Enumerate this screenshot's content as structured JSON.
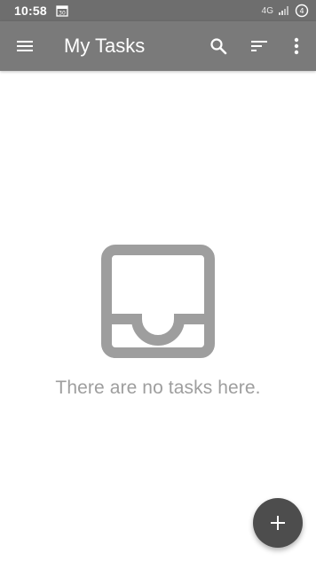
{
  "status_bar": {
    "time": "10:58",
    "calendar_icon": "calendar-icon",
    "network_label": "4G",
    "signal_icon": "signal-icon",
    "battery_icon": "battery-icon"
  },
  "app_bar": {
    "title": "My Tasks",
    "menu_icon": "menu-icon",
    "search_icon": "search-icon",
    "sort_icon": "sort-icon",
    "overflow_icon": "more-vert-icon",
    "background_color": "#7a7a7a"
  },
  "empty_state": {
    "icon": "inbox-icon",
    "message": "There are no tasks here.",
    "text_color": "#9e9e9e"
  },
  "fab": {
    "icon": "add-icon",
    "background_color": "#4d4d4d"
  }
}
